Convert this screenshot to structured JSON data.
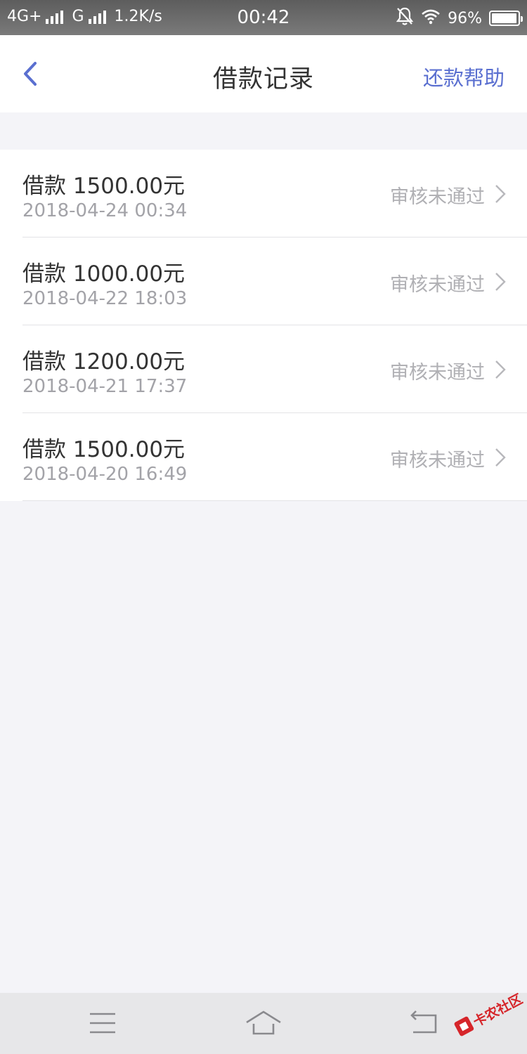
{
  "status_bar": {
    "network1": "4G+",
    "network2": "G",
    "speed": "1.2K/s",
    "time": "00:42",
    "battery_percent": "96%",
    "battery_level": 0.96,
    "icons": [
      "mute-bell-icon",
      "wifi-icon",
      "battery-icon"
    ]
  },
  "header": {
    "title": "借款记录",
    "help_label": "还款帮助",
    "back_icon": "chevron-left-icon"
  },
  "colors": {
    "accent": "#5a6fd0",
    "background": "#f4f4f8"
  },
  "records": [
    {
      "amount": "借款 1500.00元",
      "time": "2018-04-24 00:34",
      "status": "审核未通过"
    },
    {
      "amount": "借款 1000.00元",
      "time": "2018-04-22 18:03",
      "status": "审核未通过"
    },
    {
      "amount": "借款 1200.00元",
      "time": "2018-04-21 17:37",
      "status": "审核未通过"
    },
    {
      "amount": "借款 1500.00元",
      "time": "2018-04-20 16:49",
      "status": "审核未通过"
    }
  ],
  "bottom_nav": {
    "icons": [
      "menu-icon",
      "home-icon",
      "back-icon"
    ]
  },
  "watermark": {
    "text": "卡农社区"
  }
}
